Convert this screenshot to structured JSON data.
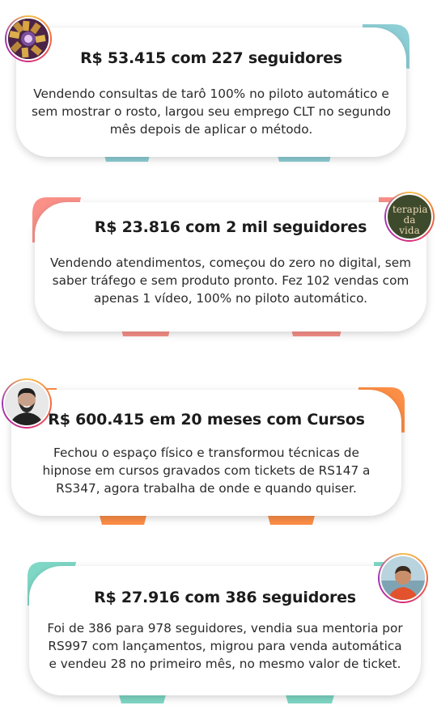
{
  "colors": {
    "teal": "#8ecfd6",
    "coral": "#f99189",
    "orange": "#fd8e46",
    "mint": "#7fd8c6"
  },
  "testimonials": [
    {
      "title": "R$ 53.415 com 227 seguidores",
      "description": "Vendendo consultas de tarô 100% no piloto automático e sem mostrar o rosto, largou seu emprego CLT no segundo mês depois de aplicar o método.",
      "avatar": "tarot-cards-avatar",
      "accent": "teal"
    },
    {
      "title": "R$ 23.816 com 2 mil seguidores",
      "description": "Vendendo atendimentos, começou do zero no digital, sem saber tráfego e sem produto pronto. Fez 102 vendas com apenas 1 vídeo, 100% no piloto automático.",
      "avatar": "terapia-da-vida-logo",
      "logo_text": "terapia da vida",
      "accent": "coral"
    },
    {
      "title": "R$ 600.415 em 20 meses com Cursos",
      "description": "Fechou o espaço físico e transformou técnicas de hipnose em cursos gravados com tickets de RS147 a RS347, agora trabalha de onde e quando quiser.",
      "avatar": "bearded-man-avatar",
      "accent": "orange"
    },
    {
      "title": "R$ 27.916 com 386 seguidores",
      "description": "Foi de 386 para 978 seguidores, vendia sua mentoria por RS997 com lançamentos, migrou para venda automática e vendeu 28 no primeiro mês, no mesmo valor de ticket.",
      "avatar": "man-outdoor-avatar",
      "accent": "mint"
    }
  ]
}
